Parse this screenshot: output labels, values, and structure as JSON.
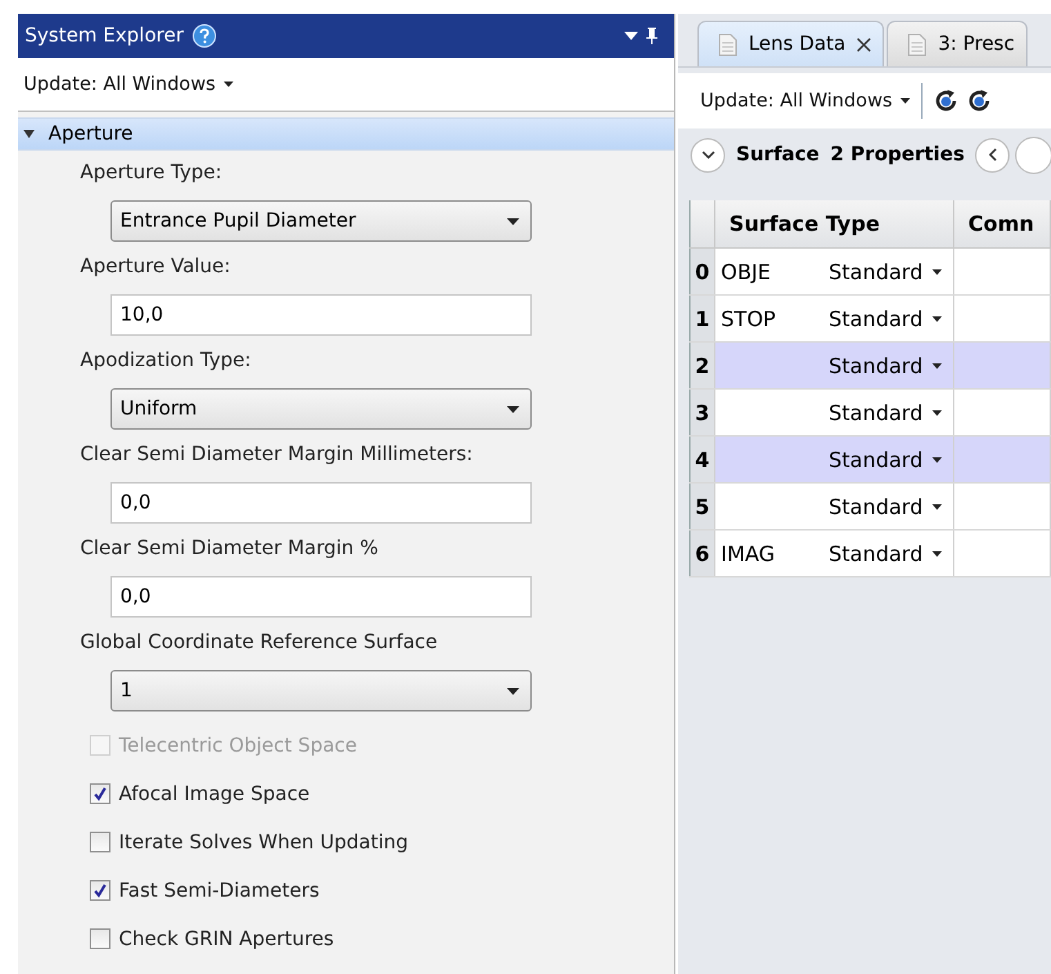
{
  "system_explorer": {
    "title": "System Explorer",
    "update_menu": "Update: All Windows",
    "section": {
      "label": "Aperture",
      "expanded": true
    },
    "fields": [
      {
        "kind": "dropdown",
        "label": "Aperture Type:",
        "value": "Entrance Pupil Diameter"
      },
      {
        "kind": "text",
        "label": "Aperture Value:",
        "value": "10,0"
      },
      {
        "kind": "dropdown",
        "label": "Apodization Type:",
        "value": "Uniform"
      },
      {
        "kind": "text",
        "label": "Clear Semi Diameter Margin Millimeters:",
        "value": "0,0"
      },
      {
        "kind": "text",
        "label": "Clear Semi Diameter Margin %",
        "value": "0,0"
      },
      {
        "kind": "dropdown",
        "label": "Global Coordinate Reference Surface",
        "value": "1"
      }
    ],
    "checkboxes": [
      {
        "label": "Telecentric Object Space",
        "checked": false,
        "disabled": true
      },
      {
        "label": "Afocal Image Space",
        "checked": true,
        "disabled": false
      },
      {
        "label": "Iterate Solves When Updating",
        "checked": false,
        "disabled": false
      },
      {
        "label": "Fast Semi-Diameters",
        "checked": true,
        "disabled": false
      },
      {
        "label": "Check GRIN Apertures",
        "checked": false,
        "disabled": false
      }
    ]
  },
  "editor": {
    "tabs": [
      {
        "label": "Lens Data",
        "selected": true,
        "closable": true
      },
      {
        "label": "3: Presc",
        "selected": false,
        "closable": false
      }
    ],
    "update_menu": "Update: All Windows",
    "surface_bar": {
      "label": "Surface",
      "properties": "2 Properties"
    },
    "table": {
      "columns": [
        "Surface Type",
        "Comn"
      ],
      "rows": [
        {
          "number": "0",
          "comment": "OBJE",
          "type": "Standard",
          "selected": false
        },
        {
          "number": "1",
          "comment": "STOP",
          "type": "Standard",
          "selected": false
        },
        {
          "number": "2",
          "comment": "",
          "type": "Standard",
          "selected": true
        },
        {
          "number": "3",
          "comment": "",
          "type": "Standard",
          "selected": false
        },
        {
          "number": "4",
          "comment": "",
          "type": "Standard",
          "selected": true
        },
        {
          "number": "5",
          "comment": "",
          "type": "Standard",
          "selected": false
        },
        {
          "number": "6",
          "comment": "IMAG",
          "type": "Standard",
          "selected": false
        }
      ]
    }
  }
}
